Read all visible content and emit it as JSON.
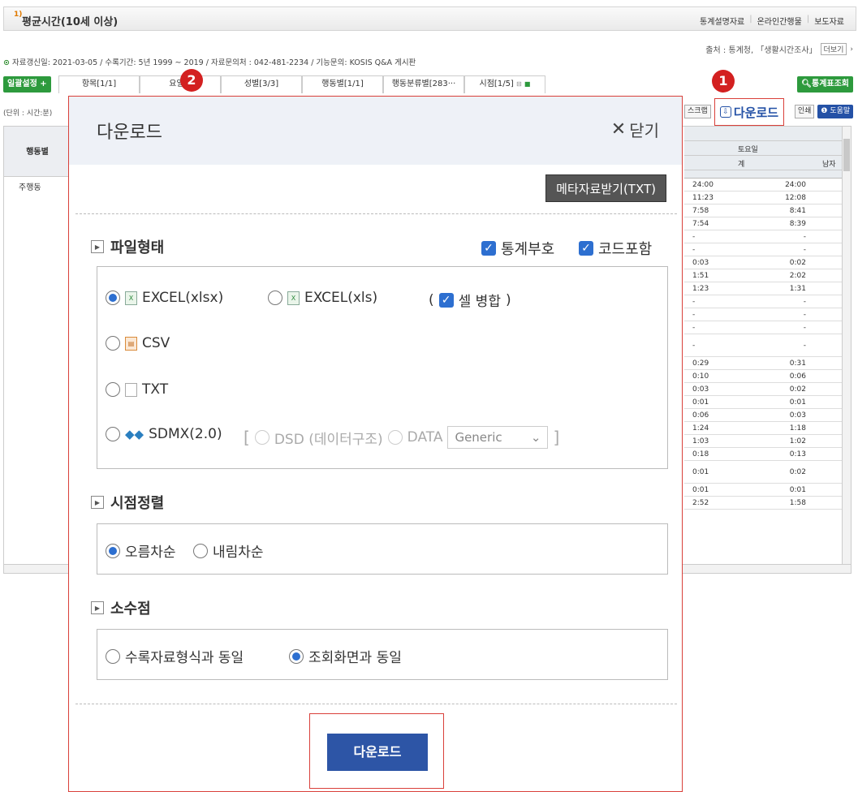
{
  "page": {
    "title": "평균시간(10세 이상)",
    "title_sup": "1)",
    "top_links": [
      "통계설명자료",
      "온라인간행물",
      "보도자료"
    ],
    "source": "출처 : 통계청, 「생활시간조사」",
    "source_more": "더보기",
    "info": "자료갱신일: 2021-03-05 / 수록기간: 5년 1999 ~ 2019 / 자료문의처 : 042-481-2234 / 기능문의: KOSIS Q&A 게시판",
    "bulk_btn": "일괄설정 +",
    "tabs": [
      "항목[1/1]",
      "요일별",
      "성별[3/3]",
      "행동별[1/1]",
      "행동분류별[283···",
      "시점[1/5]"
    ],
    "stat_btn": "통계표조회",
    "unit": "(단위 : 시간:분)",
    "scrap": "스크랩",
    "print": "인쇄",
    "help": "도움말",
    "download_top": "다운로드",
    "left_header": "행동별",
    "left_row": "주행동",
    "saturday": "토요일",
    "col_total": "계",
    "col_male": "남자",
    "col1": [
      "24:00",
      "11:23",
      "7:58",
      "7:54",
      "-",
      "-",
      "0:03",
      "1:51",
      "1:23",
      "-",
      "-",
      "-",
      "-",
      "0:29",
      "0:10",
      "0:03",
      "0:01",
      "0:06",
      "1:24",
      "1:03",
      "0:18",
      "0:01",
      "0:01",
      "2:52"
    ],
    "col2": [
      "24:00",
      "12:08",
      "8:41",
      "8:39",
      "-",
      "-",
      "0:02",
      "2:02",
      "1:31",
      "-",
      "-",
      "-",
      "-",
      "0:31",
      "0:06",
      "0:02",
      "0:01",
      "0:03",
      "1:18",
      "1:02",
      "0:13",
      "0:02",
      "0:01",
      "1:58"
    ]
  },
  "badges": [
    "1",
    "2"
  ],
  "modal": {
    "title": "다운로드",
    "close": "닫기",
    "meta_btn": "메타자료받기(TXT)",
    "sec_file": "파일형태",
    "stat_symbol": "통계부호",
    "code_incl": "코드포함",
    "xlsx": "EXCEL(xlsx)",
    "xls": "EXCEL(xls)",
    "merge": "셀 병합",
    "csv": "CSV",
    "txt": "TXT",
    "sdmx": "SDMX(2.0)",
    "dsd": "DSD (데이터구조)",
    "data": "DATA",
    "generic": "Generic",
    "sec_order": "시점정렬",
    "asc": "오름차순",
    "desc": "내림차순",
    "sec_decimal": "소수점",
    "dec_same_record": "수록자료형식과 동일",
    "dec_same_view": "조회화면과 동일",
    "download_btn": "다운로드"
  }
}
